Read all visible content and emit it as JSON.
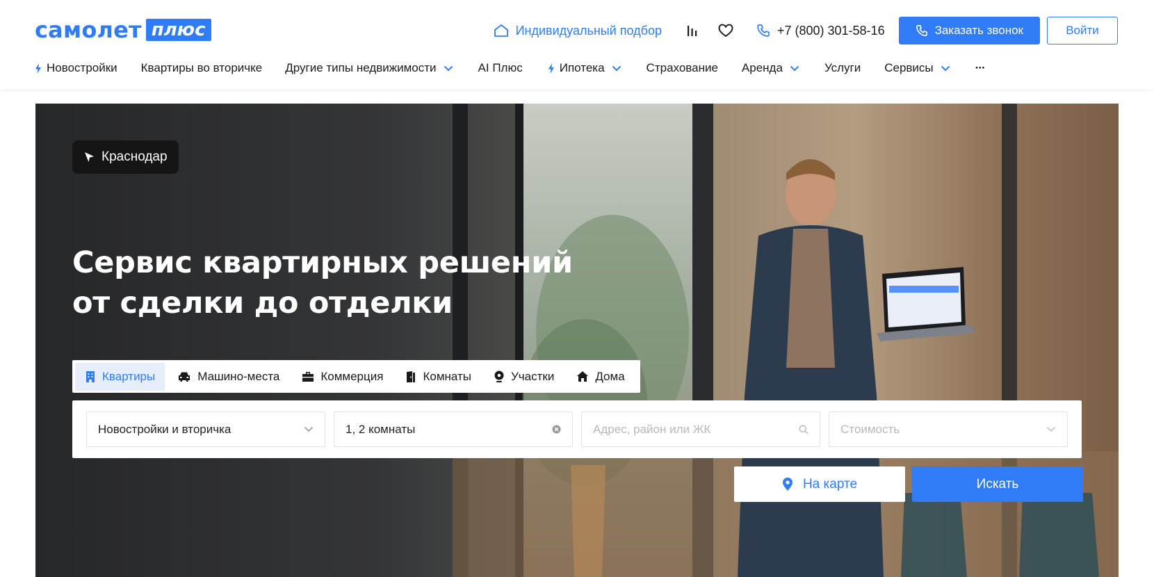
{
  "logo": {
    "word": "самолет",
    "plus": "плюс"
  },
  "header": {
    "individual_selection": "Индивидуальный подбор",
    "phone": "+7 (800) 301-58-16",
    "call_button": "Заказать звонок",
    "login_button": "Войти"
  },
  "nav": {
    "items": [
      {
        "label": "Новостройки",
        "bolt": true,
        "dropdown": false
      },
      {
        "label": "Квартиры во вторичке",
        "bolt": false,
        "dropdown": false
      },
      {
        "label": "Другие типы недвижимости",
        "bolt": false,
        "dropdown": true
      },
      {
        "label": "AI Плюс",
        "bolt": false,
        "dropdown": false
      },
      {
        "label": "Ипотека",
        "bolt": true,
        "dropdown": true
      },
      {
        "label": "Страхование",
        "bolt": false,
        "dropdown": false
      },
      {
        "label": "Аренда",
        "bolt": false,
        "dropdown": true
      },
      {
        "label": "Услуги",
        "bolt": false,
        "dropdown": false
      },
      {
        "label": "Сервисы",
        "bolt": false,
        "dropdown": true
      }
    ],
    "more": "···"
  },
  "hero": {
    "city": "Краснодар",
    "title_line1": "Сервис квартирных решений",
    "title_line2": "от сделки до отделки"
  },
  "tabs": [
    {
      "label": "Квартиры",
      "icon": "building-icon",
      "active": true
    },
    {
      "label": "Машино-места",
      "icon": "car-icon",
      "active": false
    },
    {
      "label": "Коммерция",
      "icon": "briefcase-icon",
      "active": false
    },
    {
      "label": "Комнаты",
      "icon": "door-icon",
      "active": false
    },
    {
      "label": "Участки",
      "icon": "location-pin-icon",
      "active": false
    },
    {
      "label": "Дома",
      "icon": "house-icon",
      "active": false
    }
  ],
  "search": {
    "type_value": "Новостройки и вторичка",
    "rooms_value": "1, 2 комнаты",
    "address_placeholder": "Адрес, район или ЖК",
    "price_placeholder": "Стоимость",
    "map_button": "На карте",
    "search_button": "Искать"
  },
  "colors": {
    "accent": "#2f7cf6",
    "city_bg": "#151515"
  }
}
